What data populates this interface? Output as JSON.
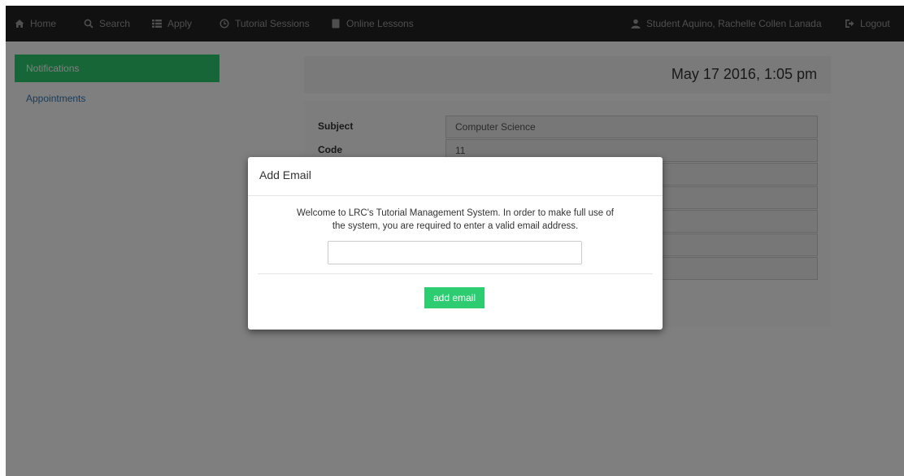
{
  "nav": {
    "home": "Home",
    "search": "Search",
    "apply": "Apply",
    "tutorial_sessions": "Tutorial Sessions",
    "online_lessons": "Online Lessons",
    "user": "Student Aquino, Rachelle Collen Lanada",
    "logout": "Logout"
  },
  "sidebar": {
    "items": [
      {
        "label": "Notifications",
        "active": true
      },
      {
        "label": "Appointments",
        "active": false
      }
    ]
  },
  "main": {
    "datetime": "May 17 2016, 1:05 pm",
    "details": [
      {
        "label": "Subject",
        "value": "Computer Science"
      },
      {
        "label": "Code",
        "value": "11"
      }
    ]
  },
  "modal": {
    "title": "Add Email",
    "message": "Welcome to LRC's Tutorial Management System. In order to make full use of the system, you are required to enter a valid email address.",
    "email_value": "",
    "button_label": "add email"
  },
  "colors": {
    "accent": "#2ecc71",
    "navbar": "#222222",
    "link": "#337ab7"
  }
}
